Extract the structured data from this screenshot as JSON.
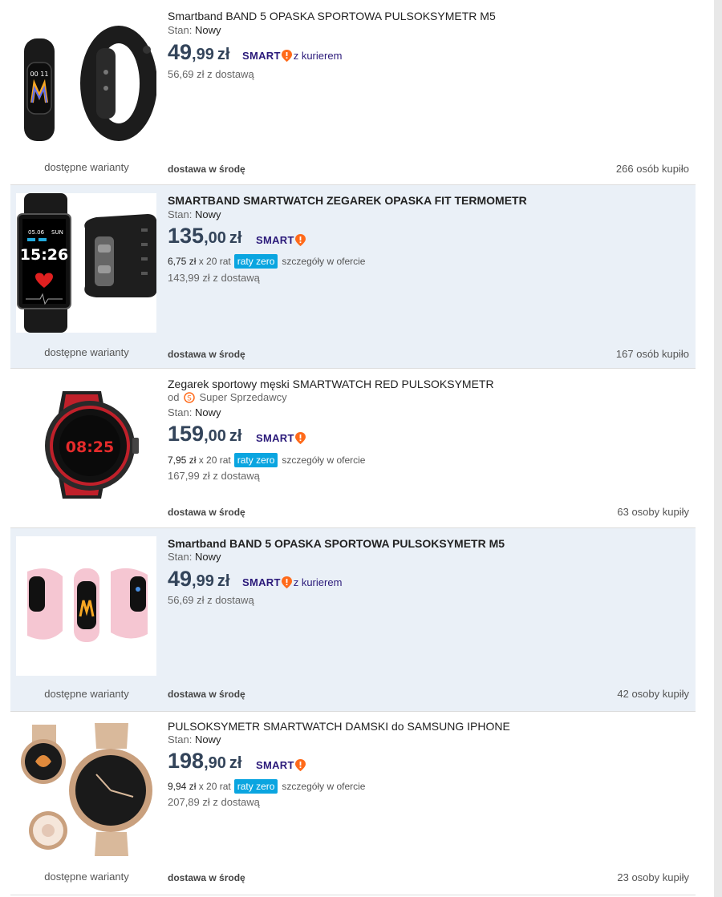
{
  "colors": {
    "price": "#33445a",
    "smart": "#2b1a7a",
    "smart_drop": "#ff6a1a",
    "raty_badge": "#0aa5e0",
    "highlight_row": "#eaf0f7"
  },
  "common": {
    "variants_label": "dostępne warianty",
    "condition_label": "Stan:",
    "smart_word": "SMART",
    "currency": "zł",
    "raty_badge": "raty zero",
    "raty_details": "szczegóły w ofercie",
    "raty_x": "x 20 rat"
  },
  "items": [
    {
      "title": "Smartband BAND 5 OPASKA SPORTOWA PULSOKSYMETR M5",
      "condition": "Nowy",
      "price_int": "49",
      "price_dec": ",99",
      "smart_suffix": "z kurierem",
      "with_delivery": "56,69 zł z dostawą",
      "delivery": "dostawa w środę",
      "bought": "266 osób kupiło",
      "image_icon": "black-smartband-image"
    },
    {
      "title": "SMARTBAND SMARTWATCH ZEGAREK OPASKA FIT TERMOMETR",
      "condition": "Nowy",
      "price_int": "135",
      "price_dec": ",00",
      "raty_amount": "6,75 zł",
      "with_delivery": "143,99 zł z dostawą",
      "delivery": "dostawa w środę",
      "bought": "167 osób kupiło",
      "watch_time": "15:26",
      "watch_date": "05.06",
      "watch_day": "SUN",
      "image_icon": "thermometer-smartwatch-image"
    },
    {
      "title": "Zegarek sportowy męski SMARTWATCH RED PULSOKSYMETR",
      "seller_prefix": "od",
      "seller": "Super Sprzedawcy",
      "condition": "Nowy",
      "price_int": "159",
      "price_dec": ",00",
      "raty_amount": "7,95 zł",
      "with_delivery": "167,99 zł z dostawą",
      "delivery": "dostawa w środę",
      "bought": "63 osoby kupiły",
      "watch_time": "08:25",
      "image_icon": "red-sport-watch-image"
    },
    {
      "title": "Smartband BAND 5 OPASKA SPORTOWA PULSOKSYMETR M5",
      "condition": "Nowy",
      "price_int": "49",
      "price_dec": ",99",
      "smart_suffix": "z kurierem",
      "with_delivery": "56,69 zł z dostawą",
      "delivery": "dostawa w środę",
      "bought": "42 osoby kupiły",
      "image_icon": "pink-smartband-image"
    },
    {
      "title": "PULSOKSYMETR SMARTWATCH DAMSKI do SAMSUNG IPHONE",
      "condition": "Nowy",
      "price_int": "198",
      "price_dec": ",90",
      "raty_amount": "9,94 zł",
      "with_delivery": "207,89 zł z dostawą",
      "delivery": "dostawa w środę",
      "bought": "23 osoby kupiły",
      "image_icon": "gold-women-watch-image"
    }
  ]
}
